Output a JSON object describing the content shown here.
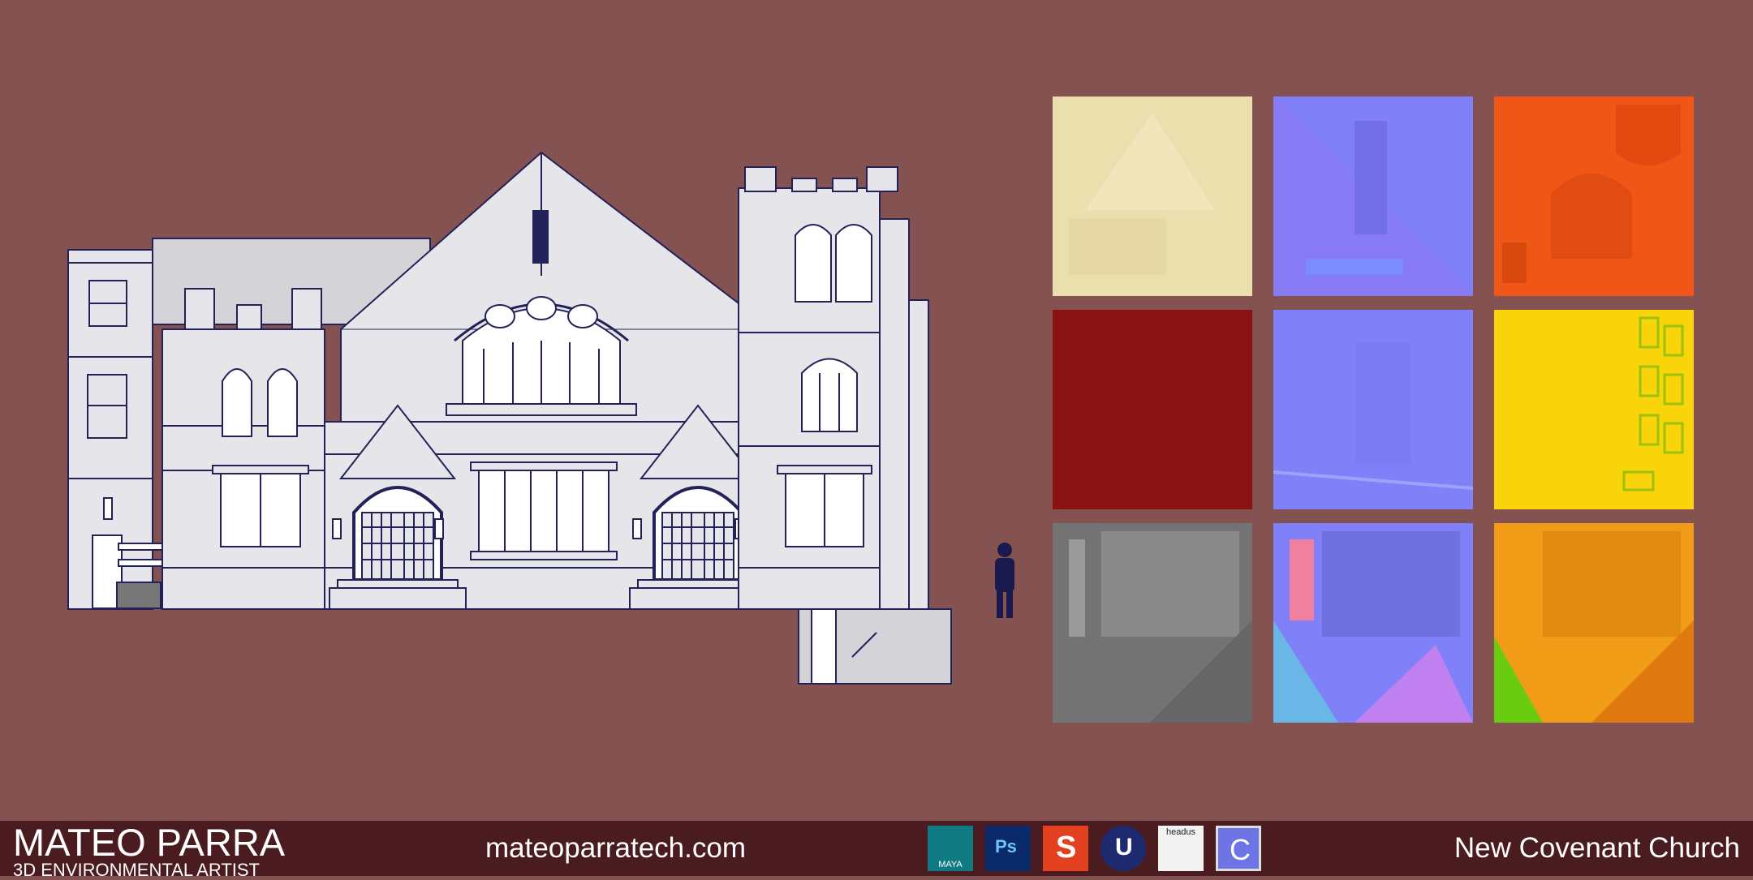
{
  "footer": {
    "artist_name": "MATEO PARRA",
    "artist_title": "3D ENVIRONMENTAL ARTIST",
    "website": "mateoparratech.com",
    "project_title": "New Covenant Church",
    "tools": [
      {
        "name": "maya",
        "label": "MAYA",
        "icon": "maya-icon",
        "color": "#0f7a82"
      },
      {
        "name": "photoshop",
        "label": "Ps",
        "icon": "photoshop-icon",
        "color": "#0b2a6a"
      },
      {
        "name": "substance",
        "label": "S",
        "icon": "substance-painter-icon",
        "color": "#e2401f"
      },
      {
        "name": "unreal",
        "label": "U",
        "icon": "unreal-engine-icon",
        "color": "#1d2a70"
      },
      {
        "name": "headus",
        "label": "headus",
        "icon": "headus-uvlayout-icon",
        "color": "#f2f2f2"
      },
      {
        "name": "crazybump",
        "label": "C",
        "icon": "crazybump-icon",
        "color": "#6d74e6"
      }
    ]
  },
  "textures": [
    {
      "name": "albedo-sheet",
      "color": "#ecdfae"
    },
    {
      "name": "normal-sheet",
      "color": "#8080f8"
    },
    {
      "name": "orm-sheet",
      "color": "#f05616"
    },
    {
      "name": "flat-red-sheet",
      "color": "#8a1212"
    },
    {
      "name": "normal-window-sheet",
      "color": "#8080f8"
    },
    {
      "name": "yellow-mask-sheet",
      "color": "#fad40a"
    },
    {
      "name": "grey-trim-sheet",
      "color": "#737373"
    },
    {
      "name": "trim-normal-sheet",
      "color": "#8080f8"
    },
    {
      "name": "trim-orange-sheet",
      "color": "#f09c16"
    }
  ],
  "colors": {
    "background": "#855252",
    "footer": "#4a1b1f",
    "wireframe": "#202050",
    "wall": "#e6e6ea"
  }
}
